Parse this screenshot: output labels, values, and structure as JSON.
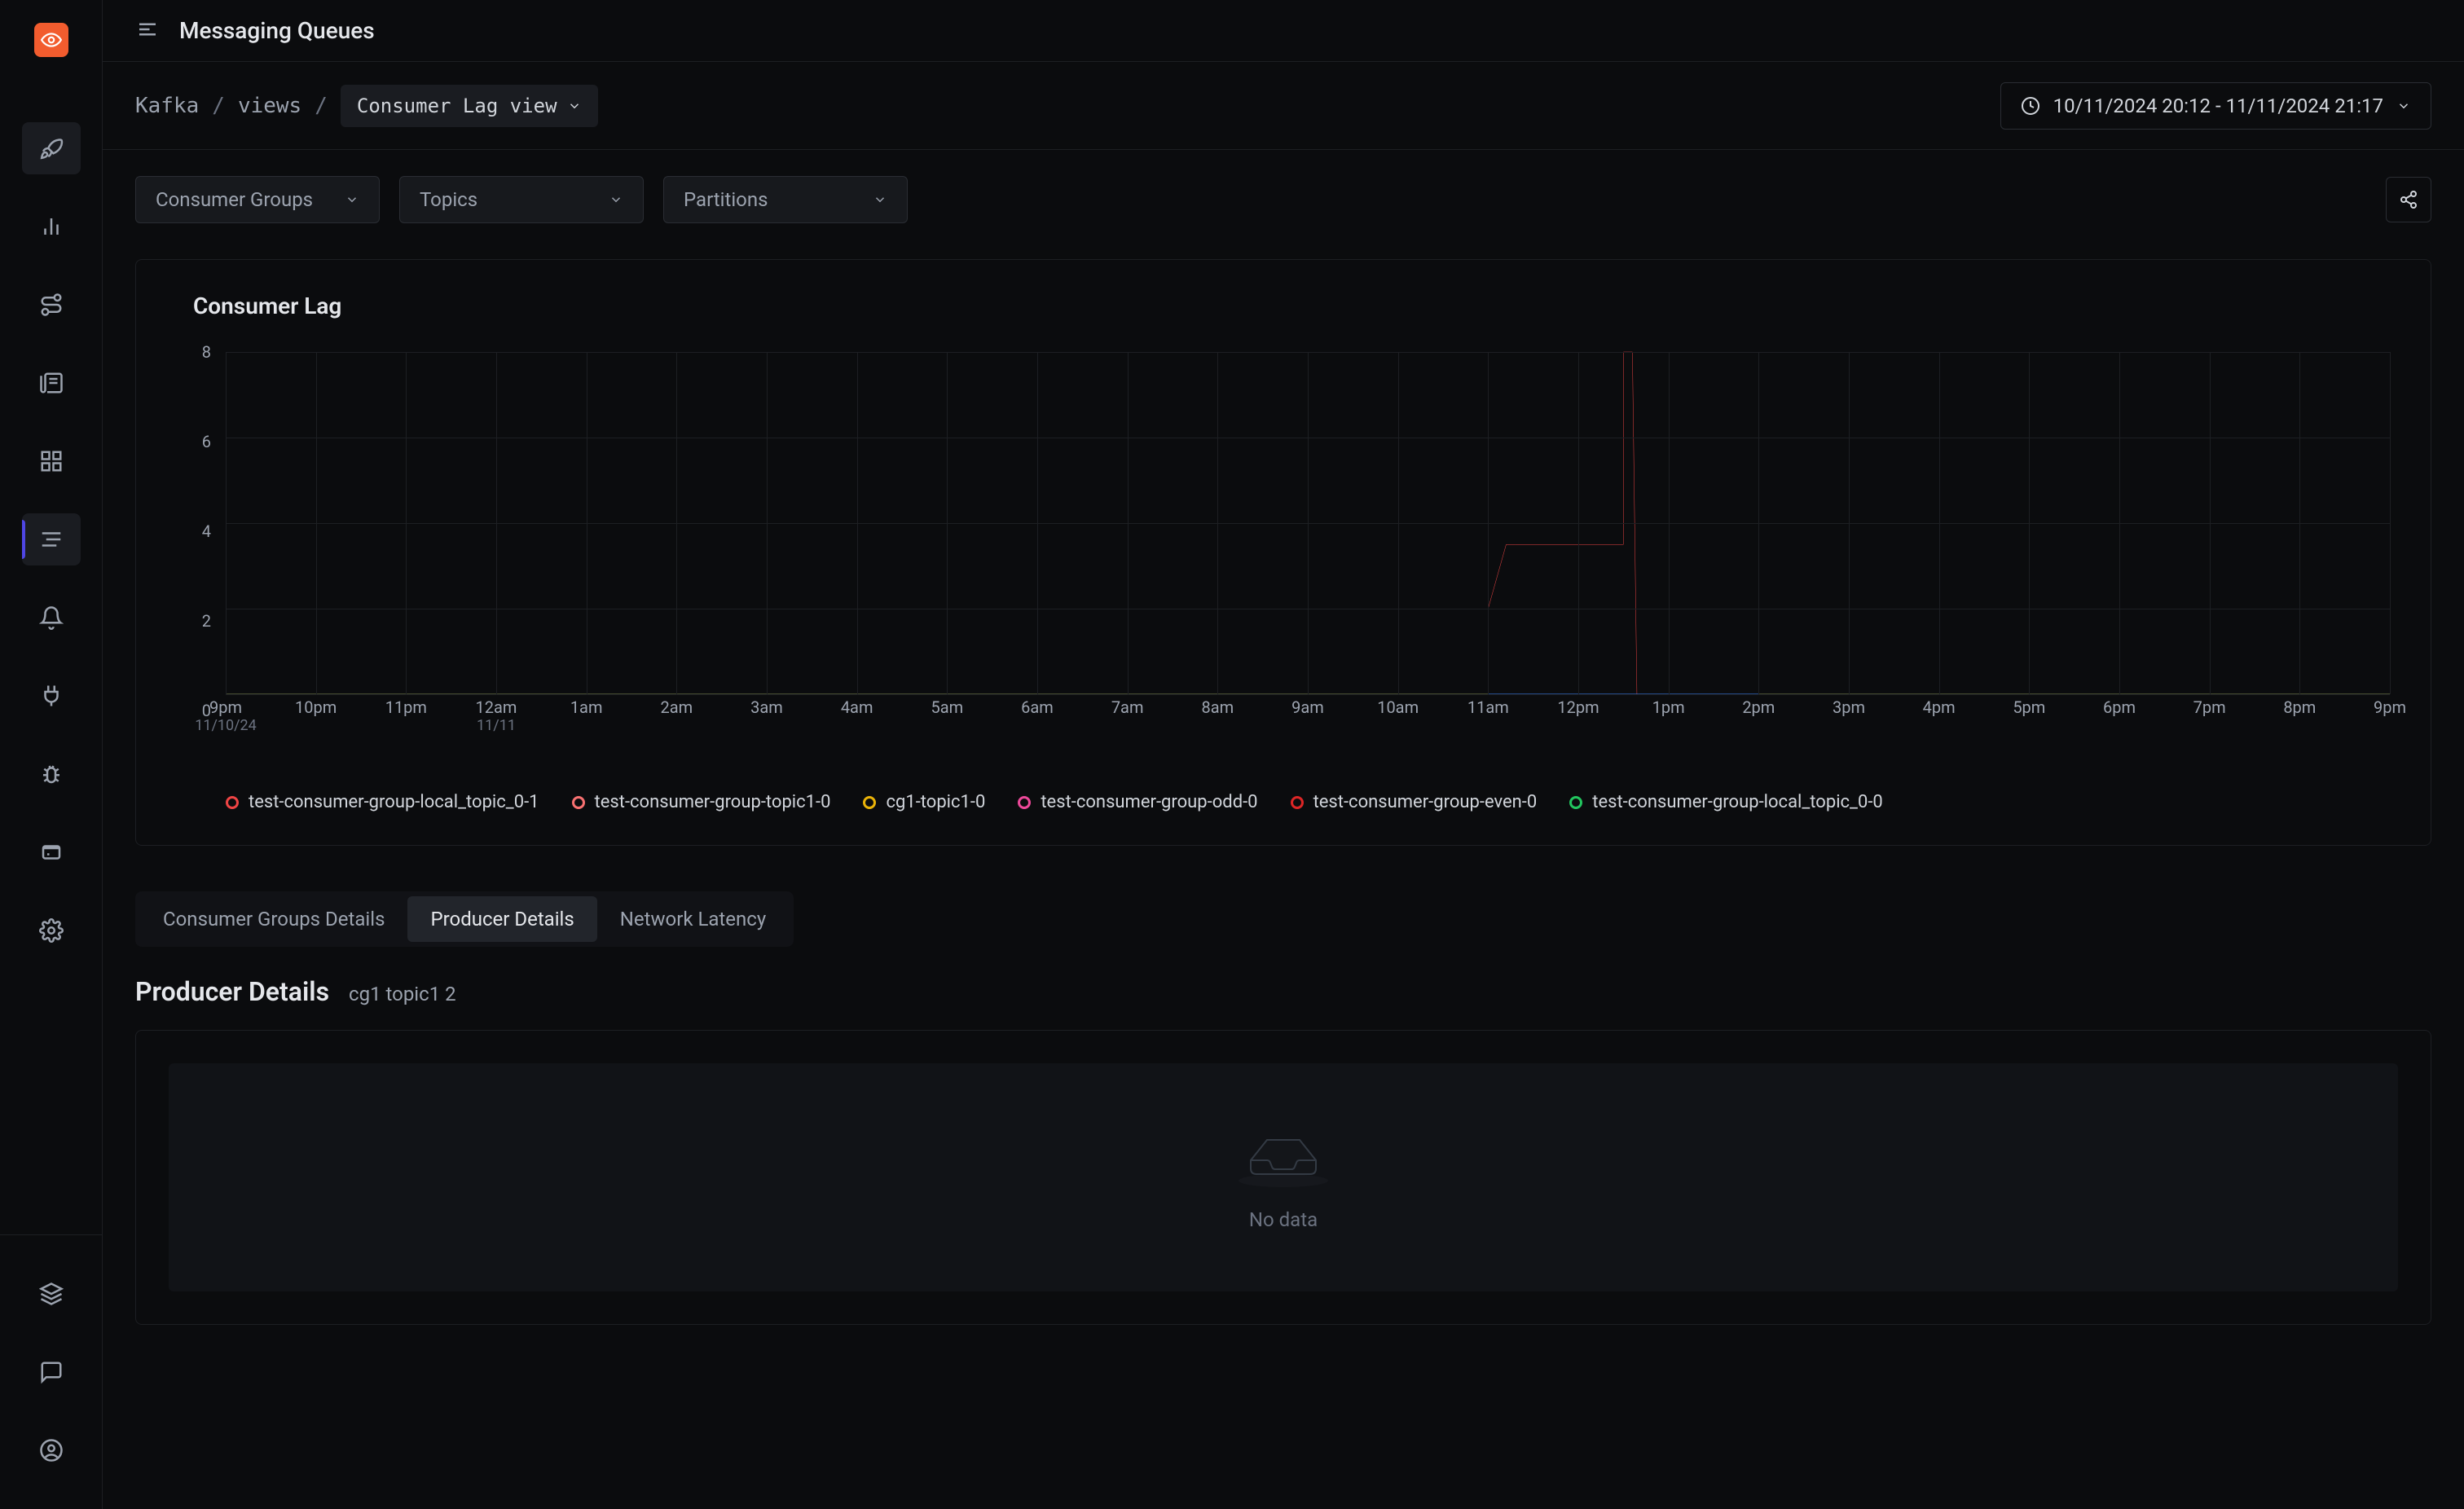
{
  "header": {
    "title": "Messaging Queues"
  },
  "breadcrumb": {
    "items": [
      "Kafka",
      "views"
    ],
    "view_label": "Consumer Lag view"
  },
  "time_range": "10/11/2024 20:12 - 11/11/2024 21:17",
  "filters": {
    "consumer_groups": "Consumer Groups",
    "topics": "Topics",
    "partitions": "Partitions"
  },
  "chart": {
    "title": "Consumer Lag"
  },
  "chart_data": {
    "type": "line",
    "ylabel": "",
    "ylim": [
      0,
      8
    ],
    "y_ticks": [
      0,
      2,
      4,
      6,
      8
    ],
    "x_ticks": [
      {
        "label": "9pm",
        "sub": "11/10/24"
      },
      {
        "label": "10pm"
      },
      {
        "label": "11pm"
      },
      {
        "label": "12am",
        "sub": "11/11"
      },
      {
        "label": "1am"
      },
      {
        "label": "2am"
      },
      {
        "label": "3am"
      },
      {
        "label": "4am"
      },
      {
        "label": "5am"
      },
      {
        "label": "6am"
      },
      {
        "label": "7am"
      },
      {
        "label": "8am"
      },
      {
        "label": "9am"
      },
      {
        "label": "10am"
      },
      {
        "label": "11am"
      },
      {
        "label": "12pm"
      },
      {
        "label": "1pm"
      },
      {
        "label": "2pm"
      },
      {
        "label": "3pm"
      },
      {
        "label": "4pm"
      },
      {
        "label": "5pm"
      },
      {
        "label": "6pm"
      },
      {
        "label": "7pm"
      },
      {
        "label": "8pm"
      },
      {
        "label": "9pm"
      }
    ],
    "series": [
      {
        "name": "test-consumer-group-local_topic_0-1",
        "color": "#ef4444",
        "points": [
          [
            14,
            0
          ],
          [
            14,
            2
          ],
          [
            14.2,
            3.5
          ],
          [
            14.3,
            3.5
          ],
          [
            15.5,
            3.5
          ],
          [
            15.5,
            8
          ],
          [
            15.6,
            8
          ],
          [
            15.65,
            0
          ],
          [
            15.7,
            0
          ]
        ]
      },
      {
        "name": "test-consumer-group-topic1-0",
        "color": "#f87171",
        "points": [
          [
            0,
            0
          ],
          [
            24,
            0
          ]
        ]
      },
      {
        "name": "cg1-topic1-0",
        "color": "#eab308",
        "points": [
          [
            0,
            0
          ],
          [
            24,
            0
          ]
        ]
      },
      {
        "name": "test-consumer-group-odd-0",
        "color": "#ec4899",
        "points": [
          [
            0,
            0
          ],
          [
            24,
            0
          ]
        ]
      },
      {
        "name": "test-consumer-group-even-0",
        "color": "#dc2626",
        "points": [
          [
            0,
            0
          ],
          [
            24,
            0
          ]
        ]
      },
      {
        "name": "test-consumer-group-local_topic_0-0",
        "color": "#22c55e",
        "points": [
          [
            0,
            0
          ],
          [
            24,
            0
          ]
        ]
      }
    ],
    "blue_segment": {
      "color": "#3b82f6",
      "points": [
        [
          14,
          0
        ],
        [
          17,
          0
        ]
      ]
    }
  },
  "tabs": {
    "items": [
      "Consumer Groups Details",
      "Producer Details",
      "Network Latency"
    ],
    "active": 1
  },
  "detail": {
    "title": "Producer Details",
    "subtitle": "cg1 topic1 2",
    "empty": "No data"
  }
}
